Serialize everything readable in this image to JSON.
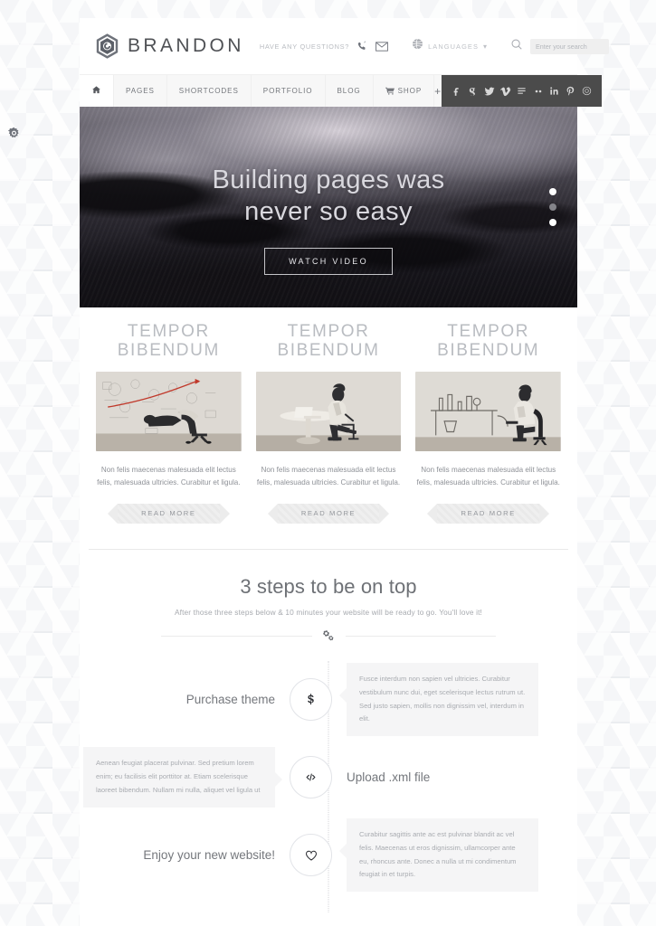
{
  "header": {
    "logo_text": "BRANDON",
    "questions_text": "HAVE ANY QUESTIONS?",
    "phone_icon": "phone-icon",
    "mail_icon": "envelope-icon",
    "languages_label": "LANGUAGES",
    "globe_icon": "globe-icon",
    "caret_icon": "chevron-down-icon",
    "search_icon": "search-icon",
    "search_placeholder": "Enter your search",
    "search_value": ""
  },
  "nav": {
    "home_icon": "home-icon",
    "items": [
      {
        "label": "PAGES"
      },
      {
        "label": "SHORTCODES"
      },
      {
        "label": "PORTFOLIO"
      },
      {
        "label": "BLOG"
      },
      {
        "label": "SHOP",
        "icon": "cart-icon"
      }
    ],
    "plus_label": "+",
    "social": [
      {
        "name": "facebook-icon",
        "glyph": "f"
      },
      {
        "name": "google-plus-icon",
        "glyph": "g"
      },
      {
        "name": "twitter-icon",
        "glyph": "t"
      },
      {
        "name": "vimeo-icon",
        "glyph": "V"
      },
      {
        "name": "flickr-icon",
        "glyph": "fl"
      },
      {
        "name": "dribbble-dots-icon",
        "glyph": "••"
      },
      {
        "name": "linkedin-icon",
        "glyph": "in"
      },
      {
        "name": "pinterest-icon",
        "glyph": "p"
      },
      {
        "name": "instagram-icon",
        "glyph": "o"
      }
    ]
  },
  "hero": {
    "title_line1": "Building pages was",
    "title_line2": "never so easy",
    "button_label": "WATCH VIDEO",
    "slides": [
      {
        "active": true
      },
      {
        "active": false
      },
      {
        "active": true
      }
    ]
  },
  "features": {
    "columns": [
      {
        "title_line1": "TEMPOR",
        "title_line2": "BIBENDUM",
        "desc": "Non felis maecenas malesuada elit lectus felis, malesuada ultricies. Curabitur et ligula.",
        "button_label": "READ MORE",
        "image_alt": "man leaning back in office chair against sketched wall"
      },
      {
        "title_line1": "TEMPOR",
        "title_line2": "BIBENDUM",
        "desc": "Non felis maecenas malesuada elit lectus felis, malesuada ultricies. Curabitur et ligula.",
        "button_label": "READ MORE",
        "image_alt": "man working on laptop at round table"
      },
      {
        "title_line1": "TEMPOR",
        "title_line2": "BIBENDUM",
        "desc": "Non felis maecenas malesuada elit lectus felis, malesuada ultricies. Curabitur et ligula.",
        "button_label": "READ MORE",
        "image_alt": "man seated at sketched desk"
      }
    ]
  },
  "steps_section": {
    "title": "3 steps to be on top",
    "subtitle": "After those three steps below & 10 minutes your website will be ready to go. You'll love it!",
    "divider_icon": "gears-icon",
    "steps": [
      {
        "label": "Purchase theme",
        "icon": "dollar-icon",
        "icon_glyph": "$",
        "side": "right",
        "text": "Fusce interdum non sapien vel ultricies. Curabitur vestibulum nunc dui, eget scelerisque lectus rutrum ut. Sed justo sapien, mollis non dignissim vel, interdum in elit."
      },
      {
        "label": "Upload .xml file",
        "icon": "code-icon",
        "icon_glyph": "</>",
        "side": "left",
        "text": "Aenean feugiat placerat pulvinar. Sed pretium lorem enim; eu facilisis elit porttitor at. Etiam scelerisque laoreet bibendum. Nullam mi nulla, aliquet vel ligula ut"
      },
      {
        "label": "Enjoy your new website!",
        "icon": "heart-icon",
        "icon_glyph": "♡",
        "side": "right",
        "text": "Curabitur sagittis ante ac est pulvinar blandit ac vel felis. Maecenas ut eros dignissim, ullamcorper ante eu, rhoncus ante. Donec a nulla ut mi condimentum feugiat in et turpis."
      }
    ]
  },
  "side_panel": {
    "settings_icon": "gear-icon"
  },
  "colors": {
    "accent_dark": "#4b4b4b",
    "text_primary": "#74777c",
    "text_muted": "#a9acb1",
    "panel_bg": "#f5f5f6",
    "page_bg": "#ffffff"
  }
}
